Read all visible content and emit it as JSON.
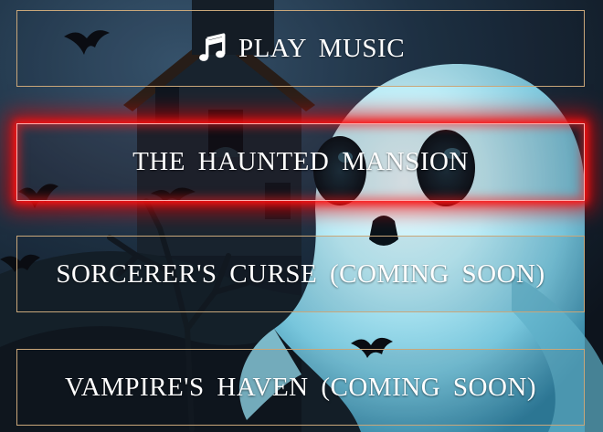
{
  "menu": {
    "play_music": {
      "label": "PLAY MUSIC",
      "icon": "music-note-icon"
    },
    "buttons": [
      {
        "label": "THE HAUNTED MANSION",
        "highlighted": true
      },
      {
        "label": "SORCERER'S CURSE (COMING SOON)",
        "highlighted": false
      },
      {
        "label": "VAMPIRE'S HAVEN (COMING SOON)",
        "highlighted": false
      }
    ]
  },
  "colors": {
    "button_border": "#c9a77a",
    "highlight_glow": "#ff1414",
    "text": "#ffffff",
    "ghost_body": "#9fe0f0",
    "sky": "#1e3447"
  }
}
